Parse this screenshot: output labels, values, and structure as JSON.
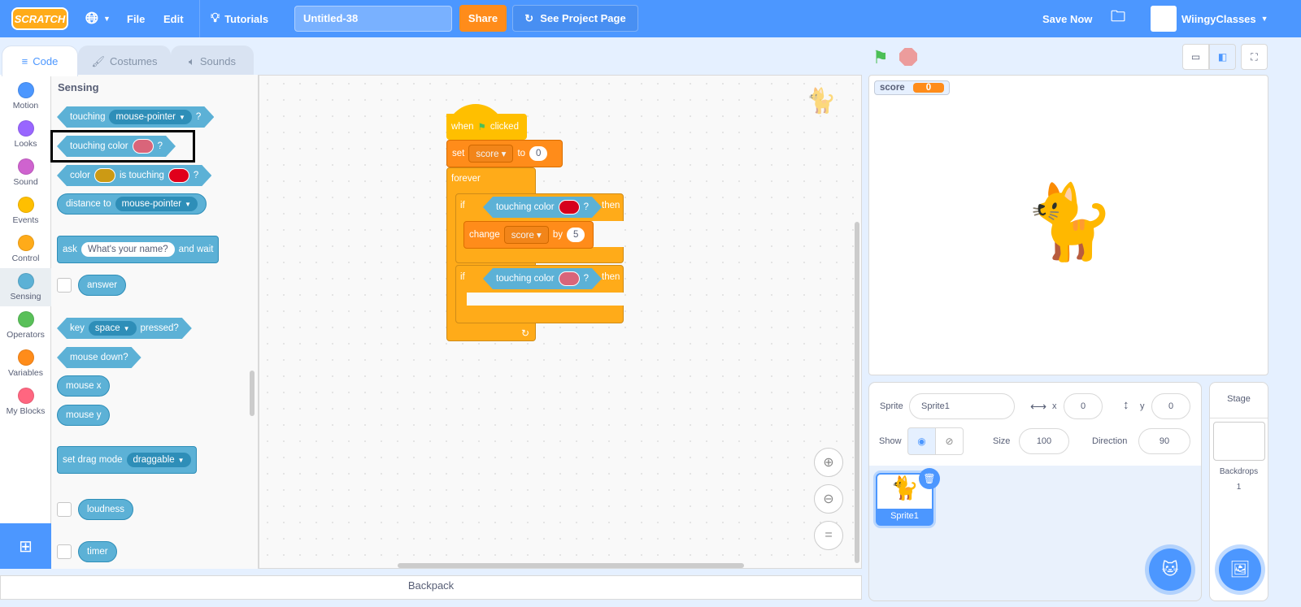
{
  "menu": {
    "logo": "SCRATCH",
    "file": "File",
    "edit": "Edit",
    "tutorials": "Tutorials",
    "project_title": "Untitled-38",
    "share": "Share",
    "see_project_page": "See Project Page",
    "save_now": "Save Now",
    "username": "WiingyClasses"
  },
  "tabs": [
    {
      "label": "Code"
    },
    {
      "label": "Costumes"
    },
    {
      "label": "Sounds"
    }
  ],
  "categories": [
    {
      "label": "Motion",
      "color": "#4c97ff"
    },
    {
      "label": "Looks",
      "color": "#9966ff"
    },
    {
      "label": "Sound",
      "color": "#cf63cf"
    },
    {
      "label": "Events",
      "color": "#ffbf00"
    },
    {
      "label": "Control",
      "color": "#ffab19"
    },
    {
      "label": "Sensing",
      "color": "#5cb1d6"
    },
    {
      "label": "Operators",
      "color": "#59c059"
    },
    {
      "label": "Variables",
      "color": "#ff8c1a"
    },
    {
      "label": "My Blocks",
      "color": "#ff6680"
    }
  ],
  "palette": {
    "heading": "Sensing",
    "touching": "touching",
    "mouse_pointer": "mouse-pointer",
    "q": "?",
    "touching_color": "touching color",
    "color": "color",
    "is_touching": "is touching",
    "distance_to": "distance to",
    "ask": "ask",
    "ask_default": "What's your name?",
    "and_wait": "and wait",
    "answer": "answer",
    "key": "key",
    "space": "space",
    "pressed": "pressed?",
    "mouse_down": "mouse down?",
    "mouse_x": "mouse x",
    "mouse_y": "mouse y",
    "set_drag_mode": "set drag mode",
    "draggable": "draggable",
    "loudness": "loudness",
    "timer": "timer",
    "swatch_pink": "#d9657a",
    "swatch_gold": "#cc9a14",
    "swatch_red": "#e0001b"
  },
  "script": {
    "when": "when",
    "clicked": "clicked",
    "set": "set",
    "score": "score",
    "to": "to",
    "set_value": "0",
    "forever": "forever",
    "if": "if",
    "touching_color": "touching color",
    "q": "?",
    "then": "then",
    "change": "change",
    "by": "by",
    "change_value": "5",
    "swatch1": "#d6001c",
    "swatch2": "#d9657a"
  },
  "backpack": "Backpack",
  "stage": {
    "monitor_label": "score",
    "monitor_value": "0"
  },
  "sprite_info": {
    "sprite_label": "Sprite",
    "sprite_name": "Sprite1",
    "x_label": "x",
    "x": "0",
    "y_label": "y",
    "y": "0",
    "show_label": "Show",
    "size_label": "Size",
    "size": "100",
    "direction_label": "Direction",
    "direction": "90"
  },
  "sprites": [
    {
      "name": "Sprite1"
    }
  ],
  "stage_panel": {
    "title": "Stage",
    "backdrops_label": "Backdrops",
    "backdrops_count": "1"
  }
}
